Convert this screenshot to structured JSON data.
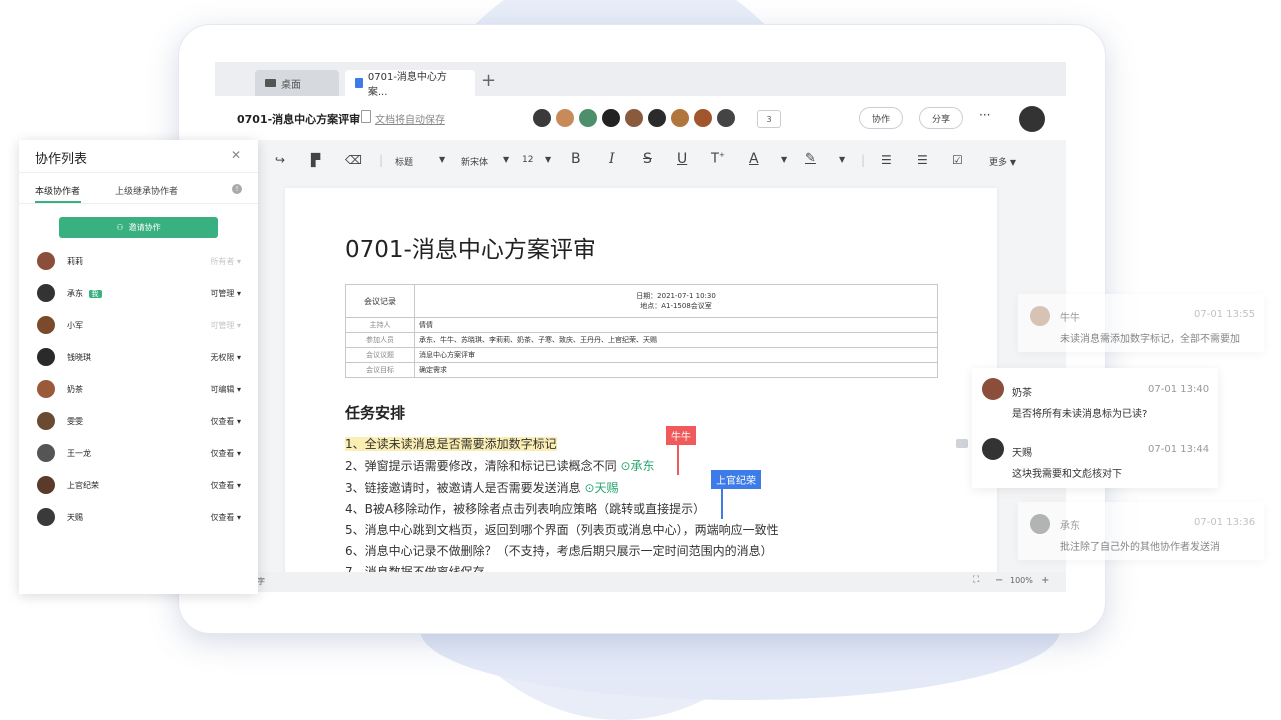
{
  "tabs": {
    "desktop": "桌面",
    "doc": "0701-消息中心方案..."
  },
  "header": {
    "doc_title": "0701-消息中心方案评审",
    "autosave": "文档将自动保存",
    "viewer_count": "3",
    "collab_btn": "协作",
    "share_btn": "分享",
    "more": "···"
  },
  "toolbar": {
    "style": "标题",
    "font": "新宋体",
    "size": "12",
    "more": "更多"
  },
  "doc": {
    "title": "0701-消息中心方案评审",
    "table": {
      "header_label": "会议记录",
      "date_line": "日期：2021-07-1 10:30",
      "place_line": "地点：A1-1508会议室",
      "rows": [
        {
          "k": "主持人",
          "v": "倩倩"
        },
        {
          "k": "参加人员",
          "v": "承东、牛牛、苏晓琪、李莉莉、奶茶、子寒、致庆、王丹丹、上官纪荣、天赐"
        },
        {
          "k": "会议议题",
          "v": "消息中心方案评审"
        },
        {
          "k": "会议目标",
          "v": "确定需求"
        }
      ]
    },
    "section": "任务安排",
    "tasks": [
      "1、全读未读消息是否需要添加数字标记",
      "2、弹窗提示语需要修改，清除和标记已读概念不同",
      "3、链接邀请时，被邀请人是否需要发送消息",
      "4、B被A移除动作，被移除者点击列表响应策略（跳转或直接提示）",
      "5、消息中心跳到文档页，返回到哪个界面（列表页或消息中心），两端响应一致性",
      "6、消息中心记录不做删除？（不支持，考虑后期只展示一定时间范围内的消息）",
      "7、消息数据不做离线保存"
    ],
    "mention_2": "承东",
    "mention_3": "天赐",
    "flag_red": "牛牛",
    "flag_blue": "上官纪荣"
  },
  "statusbar": {
    "left": "字",
    "zoom": "100%",
    "minus": "−",
    "plus": "+"
  },
  "panel": {
    "title": "协作列表",
    "tab_current": "本级协作者",
    "tab_parent": "上级继承协作者",
    "invite": "邀请协作",
    "members": [
      {
        "name": "莉莉",
        "perm": "所有者",
        "badge": ""
      },
      {
        "name": "承东",
        "perm": "可管理",
        "badge": "我"
      },
      {
        "name": "小军",
        "perm": "可管理",
        "badge": ""
      },
      {
        "name": "钱晓琪",
        "perm": "无权限",
        "badge": ""
      },
      {
        "name": "奶茶",
        "perm": "可编辑",
        "badge": ""
      },
      {
        "name": "雯雯",
        "perm": "仅查看",
        "badge": ""
      },
      {
        "name": "王一龙",
        "perm": "仅查看",
        "badge": ""
      },
      {
        "name": "上官纪荣",
        "perm": "仅查看",
        "badge": ""
      },
      {
        "name": "天赐",
        "perm": "仅查看",
        "badge": ""
      }
    ]
  },
  "comments": [
    {
      "name": "牛牛",
      "time": "07-01 13:55",
      "text": "未读消息需添加数字标记，全部不需要加"
    },
    {
      "name": "奶茶",
      "time": "07-01 13:40",
      "text": "是否将所有未读消息标为已读?"
    },
    {
      "name": "天赐",
      "time": "07-01 13:44",
      "text": "这块我需要和文彪核对下"
    },
    {
      "name": "承东",
      "time": "07-01 13:36",
      "text": "批注除了自己外的其他协作者发送消"
    }
  ],
  "colors": {
    "accent_green": "#38b07f",
    "flag_red": "#f05a5a",
    "flag_blue": "#3d7be8",
    "highlight": "#fbeeb2"
  }
}
